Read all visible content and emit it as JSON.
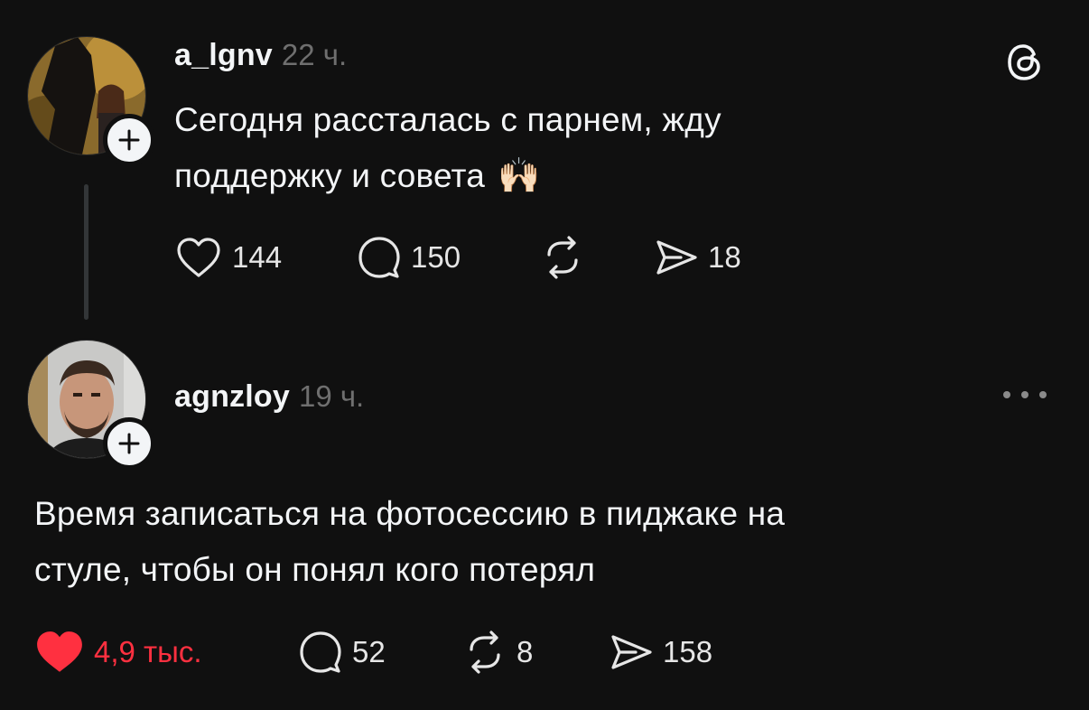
{
  "posts": [
    {
      "username": "a_lgnv",
      "time": "22 ч.",
      "text_line1": "Сегодня рассталась с парнем, жду",
      "text_line2": "поддержку и совета",
      "emoji": "🙌🏻",
      "likes": "144",
      "comments": "150",
      "reposts": "",
      "shares": "18",
      "liked": false
    },
    {
      "username": "agnzloy",
      "time": "19 ч.",
      "text_line1": "Время записаться на фотосессию в пиджаке на",
      "text_line2": "стуле, чтобы он понял кого потерял",
      "likes": "4,9 тыс.",
      "comments": "52",
      "reposts": "8",
      "shares": "158",
      "liked": true
    }
  ],
  "colors": {
    "background": "#101010",
    "text": "#f3f5f7",
    "muted": "#6f6f6f",
    "like_active": "#ff3040"
  },
  "icons": {
    "app_logo": "threads-logo-icon",
    "more": "more-options-icon",
    "like": "heart-icon",
    "comment": "comment-bubble-icon",
    "repost": "repost-icon",
    "share": "send-icon",
    "follow": "plus-icon"
  }
}
